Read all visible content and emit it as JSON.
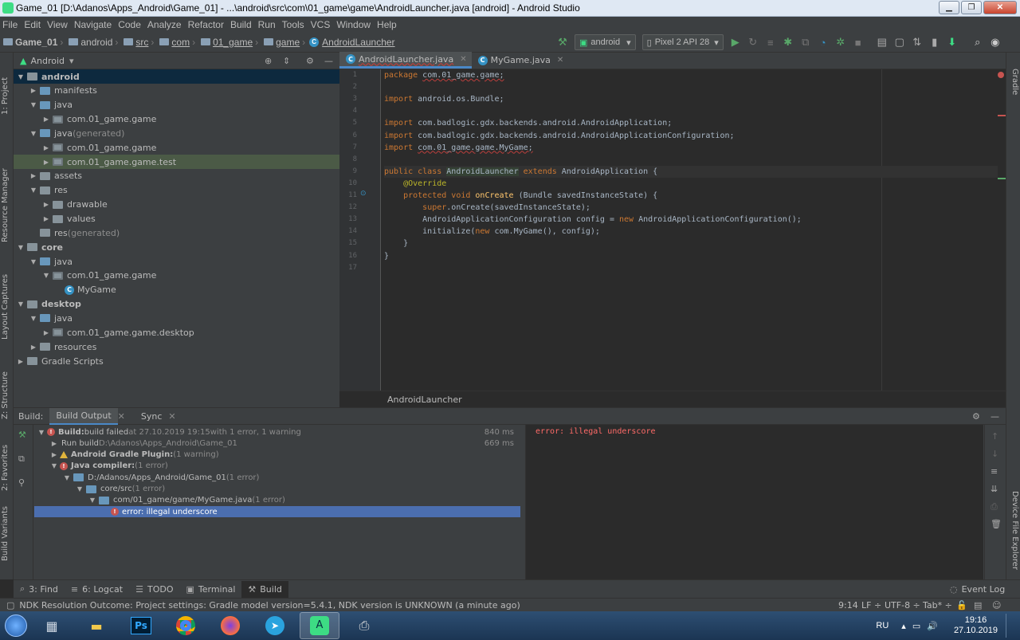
{
  "window": {
    "title": "Game_01 [D:\\Adanos\\Apps_Android\\Game_01] - ...\\android\\src\\com\\01_game\\game\\AndroidLauncher.java [android] - Android Studio",
    "minimize": "▁",
    "maximize": "❐",
    "close": "✕"
  },
  "menu": [
    "File",
    "Edit",
    "View",
    "Navigate",
    "Code",
    "Analyze",
    "Refactor",
    "Build",
    "Run",
    "Tools",
    "VCS",
    "Window",
    "Help"
  ],
  "breadcrumbs": [
    "Game_01",
    "android",
    "src",
    "com",
    "01_game",
    "game",
    "AndroidLauncher"
  ],
  "toolbar": {
    "run_config": "android",
    "device": "Pixel 2 API 28"
  },
  "left_strip": [
    "1: Project",
    "Resource Manager",
    "Layout Captures",
    "Z: Structure",
    "2: Favorites",
    "Build Variants"
  ],
  "right_strip": [
    "Gradle",
    "Device File Explorer"
  ],
  "project": {
    "view": "Android",
    "tree": [
      {
        "label": "android",
        "indent": 0,
        "arrow": "▼",
        "icon": "module",
        "bold": true,
        "state": "sel"
      },
      {
        "label": "manifests",
        "indent": 1,
        "arrow": "▶",
        "icon": "folder-blue"
      },
      {
        "label": "java",
        "indent": 1,
        "arrow": "▼",
        "icon": "folder-blue"
      },
      {
        "label": "com.01_game.game",
        "indent": 2,
        "arrow": "▶",
        "icon": "package"
      },
      {
        "label": "java",
        "suffix": " (generated)",
        "indent": 1,
        "arrow": "▼",
        "icon": "folder-blue"
      },
      {
        "label": "com.01_game.game",
        "indent": 2,
        "arrow": "▶",
        "icon": "package"
      },
      {
        "label": "com.01_game.game.test",
        "indent": 2,
        "arrow": "▶",
        "icon": "package",
        "state": "hl"
      },
      {
        "label": "assets",
        "indent": 1,
        "arrow": "▶",
        "icon": "folder"
      },
      {
        "label": "res",
        "indent": 1,
        "arrow": "▼",
        "icon": "folder"
      },
      {
        "label": "drawable",
        "indent": 2,
        "arrow": "▶",
        "icon": "folder"
      },
      {
        "label": "values",
        "indent": 2,
        "arrow": "▶",
        "icon": "folder"
      },
      {
        "label": "res",
        "suffix": " (generated)",
        "indent": 1,
        "arrow": "",
        "icon": "folder"
      },
      {
        "label": "core",
        "indent": 0,
        "arrow": "▼",
        "icon": "module",
        "bold": true
      },
      {
        "label": "java",
        "indent": 1,
        "arrow": "▼",
        "icon": "folder-blue"
      },
      {
        "label": "com.01_game.game",
        "indent": 2,
        "arrow": "▼",
        "icon": "package"
      },
      {
        "label": "MyGame",
        "indent": 3,
        "arrow": "",
        "icon": "class"
      },
      {
        "label": "desktop",
        "indent": 0,
        "arrow": "▼",
        "icon": "module",
        "bold": true
      },
      {
        "label": "java",
        "indent": 1,
        "arrow": "▼",
        "icon": "folder-blue"
      },
      {
        "label": "com.01_game.game.desktop",
        "indent": 2,
        "arrow": "▶",
        "icon": "package"
      },
      {
        "label": "resources",
        "indent": 1,
        "arrow": "▶",
        "icon": "folder"
      },
      {
        "label": "Gradle Scripts",
        "indent": 0,
        "arrow": "▶",
        "icon": "gradle"
      }
    ]
  },
  "editor": {
    "tabs": [
      {
        "label": "AndroidLauncher.java",
        "active": true
      },
      {
        "label": "MyGame.java",
        "active": false
      }
    ],
    "breadcrumb": "AndroidLauncher",
    "lines": [
      [
        {
          "t": "package ",
          "c": "kw"
        },
        {
          "t": "com.01_game.game;",
          "c": "ul"
        }
      ],
      [],
      [
        {
          "t": "import ",
          "c": "kw"
        },
        {
          "t": "android.os.Bundle;"
        }
      ],
      [],
      [
        {
          "t": "import ",
          "c": "kw"
        },
        {
          "t": "com.badlogic.gdx.backends.android.AndroidApplication;"
        }
      ],
      [
        {
          "t": "import ",
          "c": "kw"
        },
        {
          "t": "com.badlogic.gdx.backends.android.AndroidApplicationConfiguration;"
        }
      ],
      [
        {
          "t": "import ",
          "c": "kw"
        },
        {
          "t": "com.01_game.game.MyGame;",
          "c": "ul"
        }
      ],
      [],
      [
        {
          "t": "public class ",
          "c": "kw"
        },
        {
          "t": "AndroidLauncher",
          "c": "hlcls"
        },
        {
          "t": " extends ",
          "c": "kw"
        },
        {
          "t": "AndroidApplication {"
        }
      ],
      [
        {
          "t": "    "
        },
        {
          "t": "@Override",
          "c": "an"
        }
      ],
      [
        {
          "t": "    "
        },
        {
          "t": "protected void ",
          "c": "kw"
        },
        {
          "t": "onCreate",
          "c": "fn"
        },
        {
          "t": " (Bundle savedInstanceState) {"
        }
      ],
      [
        {
          "t": "        "
        },
        {
          "t": "super",
          "c": "kw"
        },
        {
          "t": ".onCreate(savedInstanceState);"
        }
      ],
      [
        {
          "t": "        AndroidApplicationConfiguration config = "
        },
        {
          "t": "new ",
          "c": "kw"
        },
        {
          "t": "AndroidApplicationConfiguration();"
        }
      ],
      [
        {
          "t": "        initialize("
        },
        {
          "t": "new ",
          "c": "kw"
        },
        {
          "t": "com.MyGame(), config);"
        }
      ],
      [
        {
          "t": "    }"
        }
      ],
      [
        {
          "t": "}"
        }
      ],
      []
    ],
    "current_line": 9
  },
  "build": {
    "header_label": "Build:",
    "tabs": [
      "Build Output",
      "Sync"
    ],
    "tree": [
      {
        "indent": 0,
        "arrow": "▼",
        "icon": "error",
        "label": "Build:",
        "bold": true,
        "after": " build failed",
        "dim": " at 27.10.2019 19:15",
        "tail": "  with 1 error, 1 warning",
        "ms": "840 ms"
      },
      {
        "indent": 1,
        "arrow": "▶",
        "icon": "none",
        "label": "Run build",
        "dim": " D:\\Adanos\\Apps_Android\\Game_01",
        "ms": "669 ms"
      },
      {
        "indent": 1,
        "arrow": "▶",
        "icon": "warning",
        "label": "Android Gradle Plugin:",
        "bold": true,
        "dim": " (1 warning)"
      },
      {
        "indent": 1,
        "arrow": "▼",
        "icon": "error",
        "label": "Java compiler:",
        "bold": true,
        "dim": " (1 error)"
      },
      {
        "indent": 2,
        "arrow": "▼",
        "icon": "folder",
        "label": "D:/Adanos/Apps_Android/Game_01",
        "dim": "  (1 error)"
      },
      {
        "indent": 3,
        "arrow": "▼",
        "icon": "folder",
        "label": "core/src",
        "dim": "  (1 error)"
      },
      {
        "indent": 4,
        "arrow": "▼",
        "icon": "file",
        "label": "com/01_game/game/MyGame.java",
        "dim": "  (1 error)"
      },
      {
        "indent": 5,
        "arrow": "",
        "icon": "error",
        "label": "error: illegal underscore",
        "sel": true
      }
    ],
    "output": "error: illegal underscore"
  },
  "bottom_tools": [
    "3: Find",
    "6: Logcat",
    "TODO",
    "Terminal",
    "Build"
  ],
  "event_log": "Event Log",
  "status": {
    "message": "NDK Resolution Outcome: Project settings: Gradle model version=5.4.1, NDK version is UNKNOWN (a minute ago)",
    "position": "9:14",
    "line_sep": "LF ÷",
    "encoding": "UTF-8 ÷",
    "indent": "Tab* ÷"
  },
  "taskbar": {
    "lang": "RU",
    "time": "19:16",
    "date": "27.10.2019"
  },
  "colors": {
    "accent": "#4a88c7",
    "error": "#c75450",
    "selection": "#4b6eaf",
    "ide_bg": "#2b2b2b",
    "panel_bg": "#3c3f41"
  }
}
